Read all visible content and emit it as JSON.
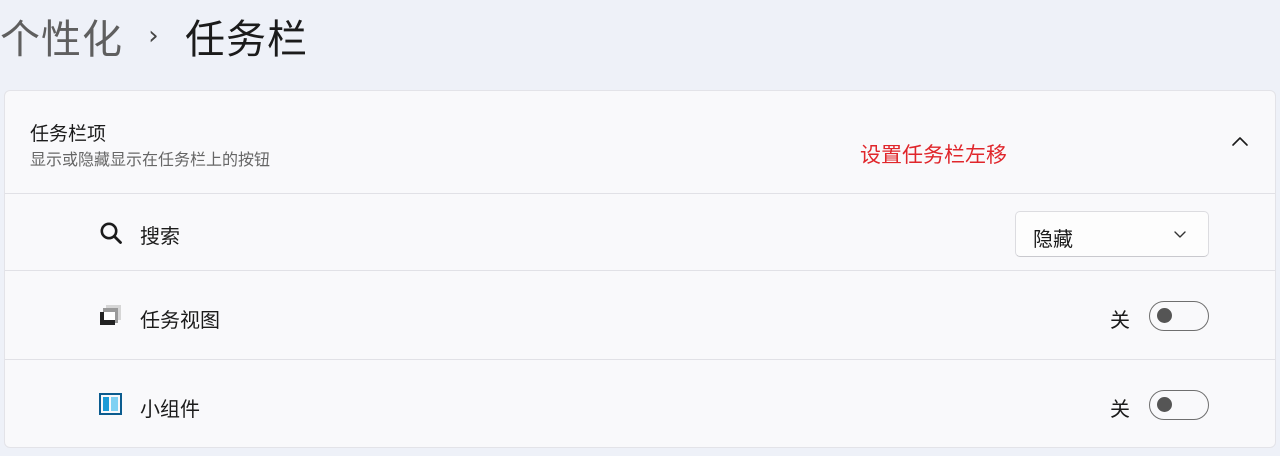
{
  "breadcrumb": {
    "parent": "个性化",
    "separator": "›",
    "current": "任务栏"
  },
  "section": {
    "title": "任务栏项",
    "subtitle": "显示或隐藏显示在任务栏上的按钮",
    "annotation": "设置任务栏左移",
    "annotation_color": "#e0262b",
    "collapse_icon": "chevron-up-icon"
  },
  "items": [
    {
      "icon": "search-icon",
      "label": "搜索",
      "control": "dropdown",
      "value": "隐藏"
    },
    {
      "icon": "task-view-icon",
      "label": "任务视图",
      "control": "toggle",
      "state_label": "关",
      "on": false
    },
    {
      "icon": "widgets-icon",
      "label": "小组件",
      "control": "toggle",
      "state_label": "关",
      "on": false
    }
  ],
  "colors": {
    "background": "#eef1f8",
    "card": "#f9f9fb",
    "widgets_accent": "#1a9bd7"
  }
}
